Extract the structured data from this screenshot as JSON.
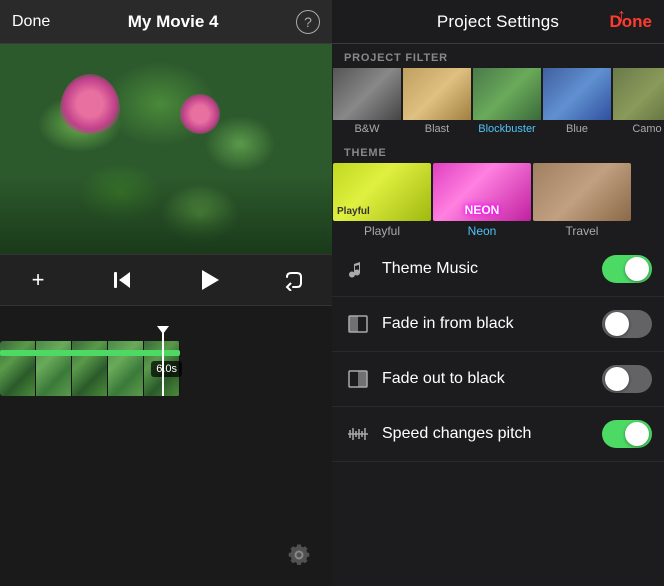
{
  "left": {
    "header": {
      "done_label": "Done",
      "title": "My Movie 4",
      "help_label": "?"
    },
    "timeline": {
      "duration_badge": "6.0s"
    },
    "controls": {
      "add_label": "+",
      "skip_back_label": "⏮",
      "play_label": "▶",
      "undo_label": "↩"
    },
    "settings_icon": "⚙"
  },
  "right": {
    "header": {
      "title": "Project Settings",
      "done_label": "Done"
    },
    "project_filter": {
      "section_label": "PROJECT FILTER",
      "filters": [
        {
          "name": "B&W",
          "active": false
        },
        {
          "name": "Blast",
          "active": false
        },
        {
          "name": "Blockbuster",
          "active": true
        },
        {
          "name": "Blue",
          "active": false
        },
        {
          "name": "Camo",
          "active": false
        }
      ]
    },
    "theme": {
      "section_label": "THEME",
      "themes": [
        {
          "name": "Playful",
          "active": false
        },
        {
          "name": "Neon",
          "active": true
        },
        {
          "name": "Travel",
          "active": false
        }
      ]
    },
    "settings": [
      {
        "icon": "music",
        "label": "Theme Music",
        "on": true
      },
      {
        "icon": "fade_in",
        "label": "Fade in from black",
        "on": false
      },
      {
        "icon": "fade_out",
        "label": "Fade out to black",
        "on": false
      },
      {
        "icon": "speed",
        "label": "Speed changes pitch",
        "on": true
      }
    ]
  }
}
